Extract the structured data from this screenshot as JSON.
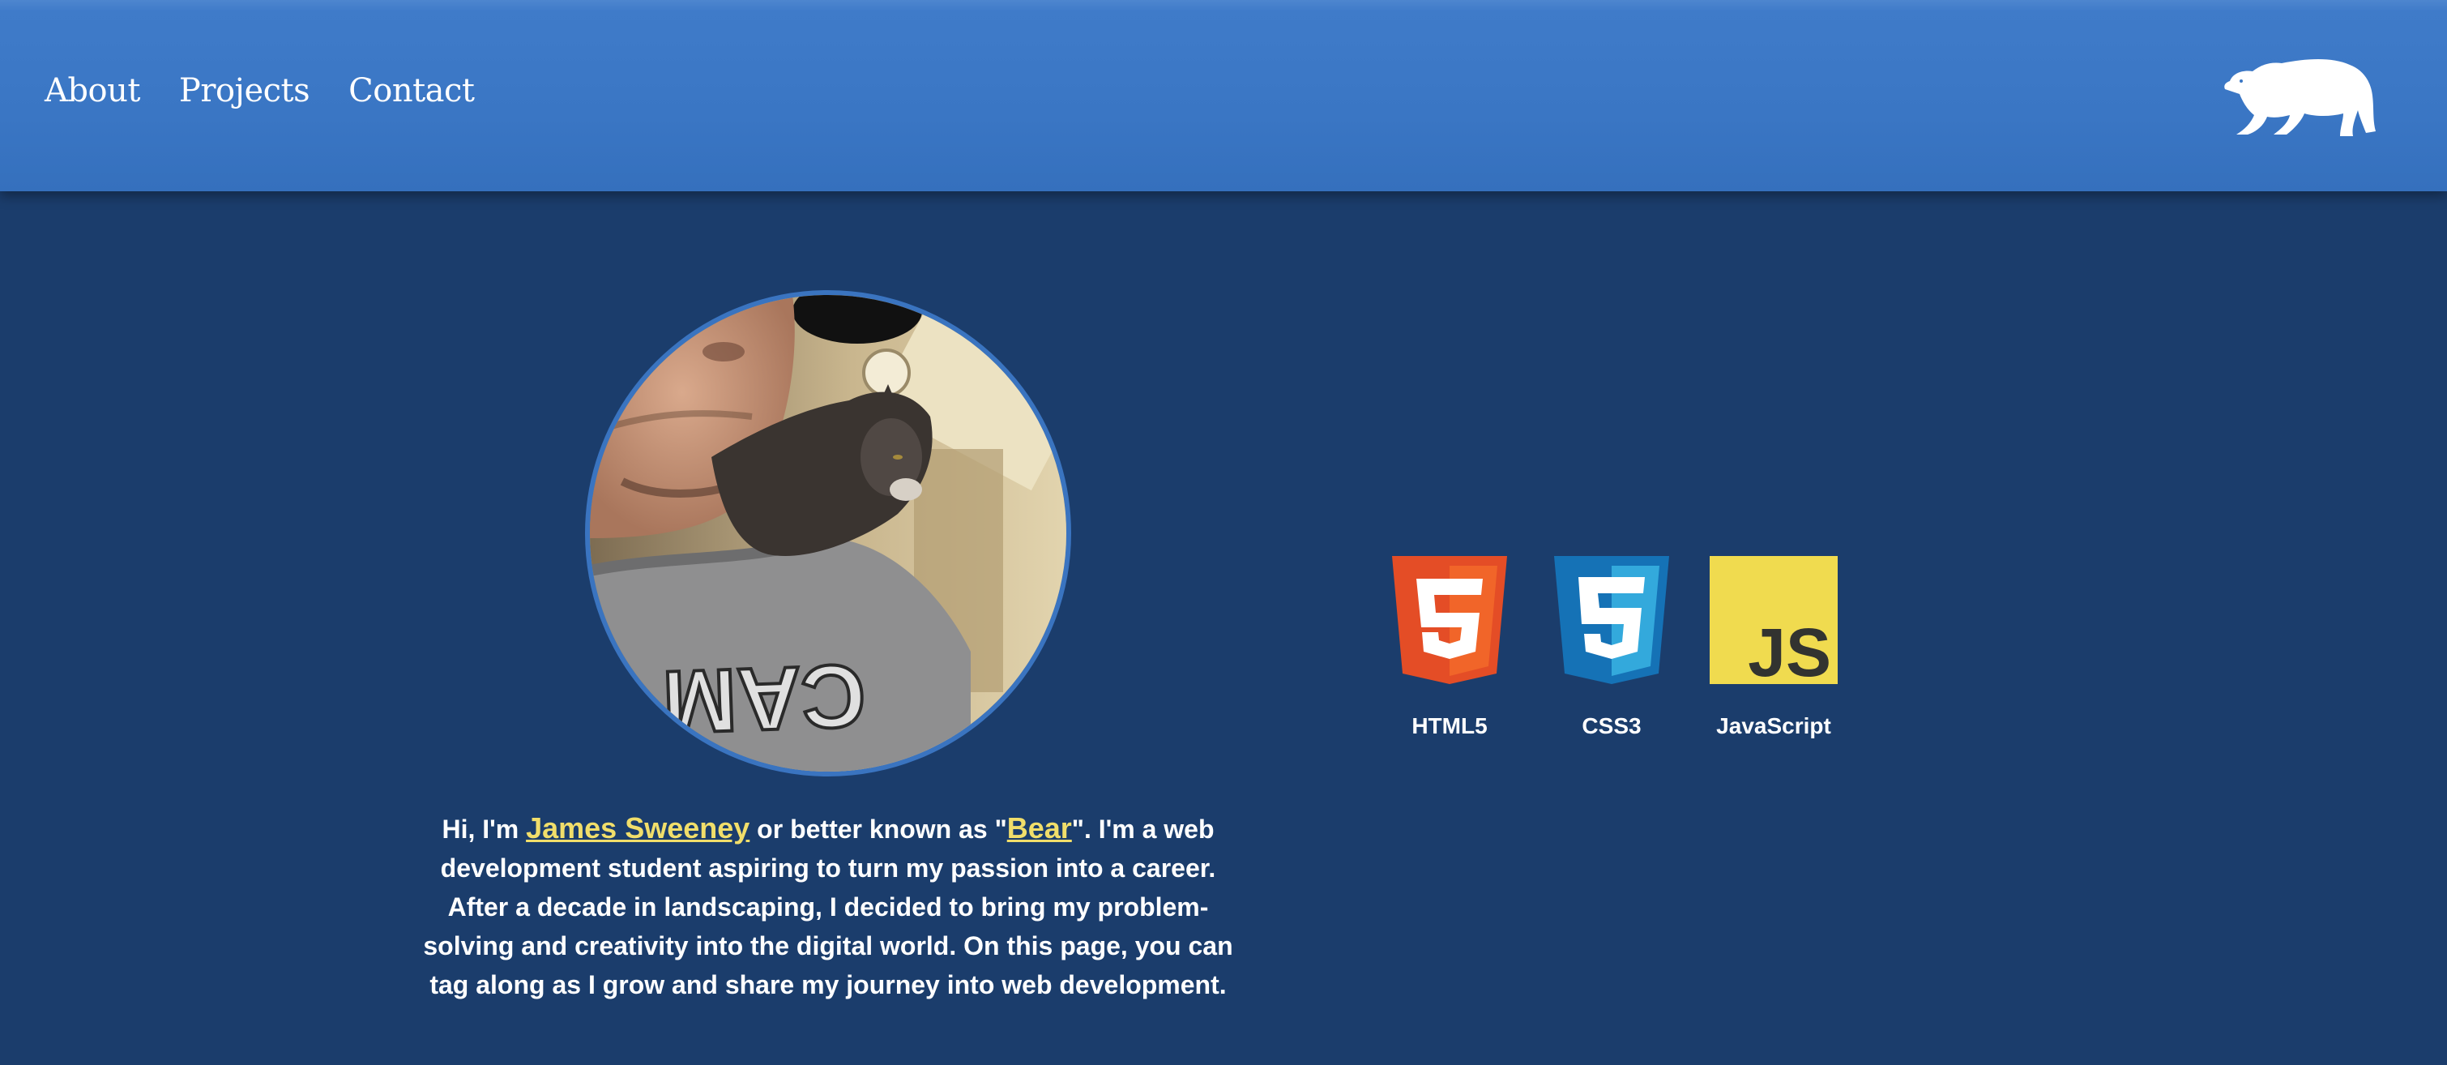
{
  "nav": {
    "items": [
      {
        "label": "About"
      },
      {
        "label": "Projects"
      },
      {
        "label": "Contact"
      }
    ]
  },
  "logo": {
    "icon": "polar-bear-icon"
  },
  "profile": {
    "photo_icon": "profile-photo",
    "bio": {
      "prefix": "Hi, I'm ",
      "name_link": "James Sweeney",
      "middle": " or better known as \"",
      "nickname_link": "Bear",
      "suffix": "\". I'm a web development student aspiring to turn my passion into a career. After a decade in landscaping, I decided to bring my problem-solving and creativity into the digital world. On this page, you can tag along as I grow and share my journey into web development."
    }
  },
  "skills": [
    {
      "label": "HTML5",
      "icon": "html5-icon",
      "color": "#e44d26"
    },
    {
      "label": "CSS3",
      "icon": "css3-icon",
      "color": "#2965f1"
    },
    {
      "label": "JavaScript",
      "icon": "javascript-icon",
      "color": "#f0db4f"
    }
  ],
  "colors": {
    "header": "#3a76c4",
    "background": "#1b3d6c",
    "link": "#f1de6a"
  }
}
